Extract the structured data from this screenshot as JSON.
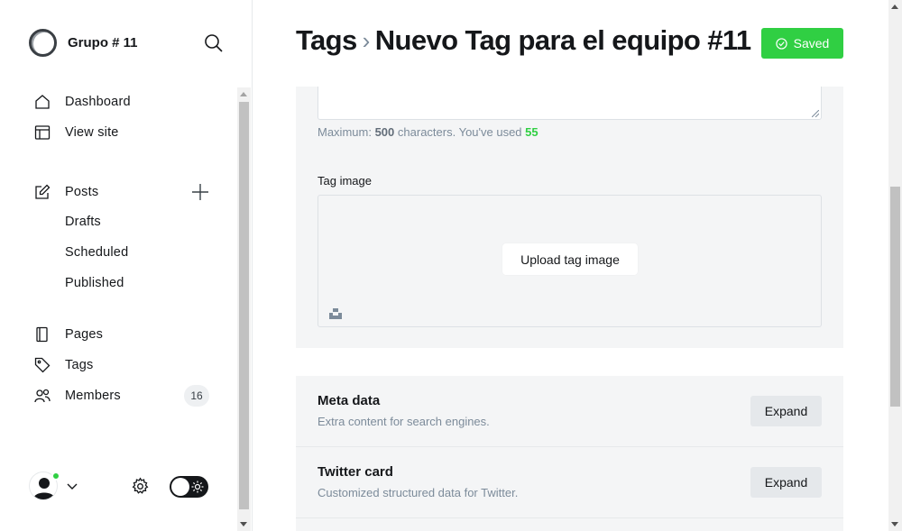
{
  "sidebar": {
    "brand": "Grupo # 11",
    "nav": {
      "dashboard": "Dashboard",
      "view_site": "View site",
      "posts": "Posts",
      "drafts": "Drafts",
      "scheduled": "Scheduled",
      "published": "Published",
      "pages": "Pages",
      "tags": "Tags",
      "members": "Members",
      "members_count": "16"
    },
    "icons": [
      "search-icon",
      "home-icon",
      "layout-icon",
      "edit-icon",
      "plus-icon",
      "page-icon",
      "tag-icon",
      "members-icon",
      "gear-icon",
      "sun-icon",
      "chevron-down-icon"
    ],
    "colors": {
      "online": "#30cf43",
      "toggle": "#15171a"
    }
  },
  "header": {
    "breadcrumb_root": "Tags",
    "breadcrumb_current": "Nuevo Tag para el equipo #11",
    "status": "Saved",
    "status_color": "#30cf43"
  },
  "form": {
    "hint_prefix": "Maximum:",
    "hint_max": "500",
    "hint_mid": "characters. You've used",
    "hint_used": "55",
    "tag_image_label": "Tag image",
    "upload_button": "Upload tag image"
  },
  "sections": [
    {
      "title": "Meta data",
      "subtitle": "Extra content for search engines.",
      "button": "Expand"
    },
    {
      "title": "Twitter card",
      "subtitle": "Customized structured data for Twitter.",
      "button": "Expand"
    }
  ]
}
